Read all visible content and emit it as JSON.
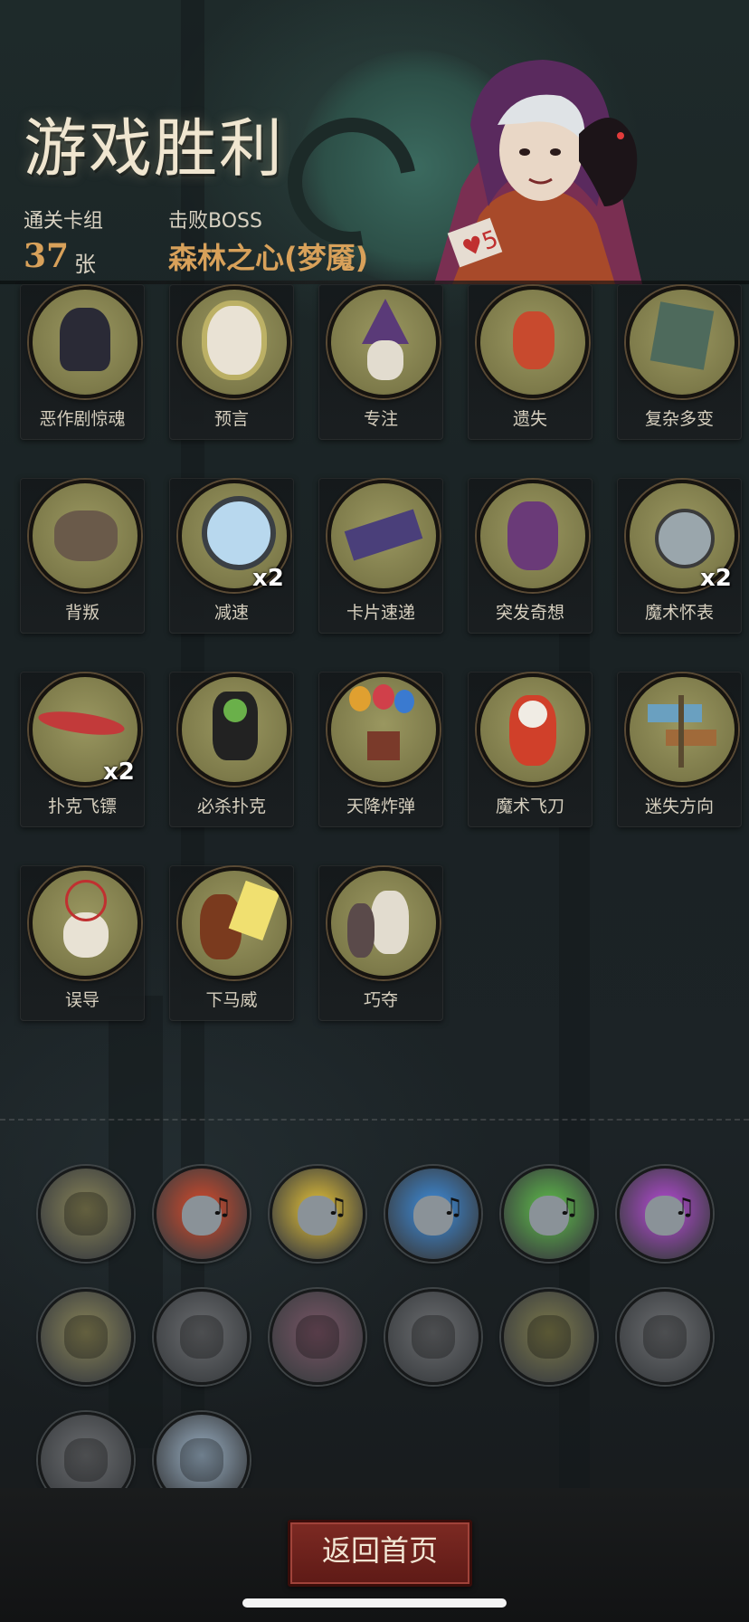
{
  "header": {
    "title": "游戏胜利",
    "deck_label": "通关卡组",
    "deck_count": "37",
    "deck_unit": "张",
    "boss_label": "击败BOSS",
    "boss_name": "森林之心(梦魇)"
  },
  "cards": [
    {
      "label": "恶作剧惊魂",
      "icon": "prank-ghost-icon"
    },
    {
      "label": "预言",
      "icon": "prophecy-sage-icon"
    },
    {
      "label": "专注",
      "icon": "focus-wizard-icon"
    },
    {
      "label": "遗失",
      "icon": "lost-pirate-icon"
    },
    {
      "label": "复杂多变",
      "icon": "complex-cube-icon"
    },
    {
      "label": "背叛",
      "icon": "betrayal-icon"
    },
    {
      "label": "减速",
      "icon": "slow-mirror-icon",
      "multiplier": "x2"
    },
    {
      "label": "卡片速递",
      "icon": "card-express-icon"
    },
    {
      "label": "突发奇想",
      "icon": "sudden-idea-icon"
    },
    {
      "label": "魔术怀表",
      "icon": "magic-pocketwatch-icon",
      "multiplier": "x2"
    },
    {
      "label": "扑克飞镖",
      "icon": "poker-dart-icon",
      "multiplier": "x2"
    },
    {
      "label": "必杀扑克",
      "icon": "killer-poker-icon"
    },
    {
      "label": "天降炸弹",
      "icon": "balloon-bomb-icon"
    },
    {
      "label": "魔术飞刀",
      "icon": "magic-knife-clown-icon"
    },
    {
      "label": "迷失方向",
      "icon": "lost-direction-signpost-icon"
    },
    {
      "label": "误导",
      "icon": "misdirect-skull-icon"
    },
    {
      "label": "下马威",
      "icon": "intimidation-icon"
    },
    {
      "label": "巧夺",
      "icon": "snatch-icon"
    }
  ],
  "relics": [
    {
      "icon": "handcuffs-relic-icon",
      "color": "#8a8557"
    },
    {
      "icon": "music-skull-red-relic-icon",
      "color": "#d94a2a"
    },
    {
      "icon": "music-skull-yellow-relic-icon",
      "color": "#e8c437"
    },
    {
      "icon": "music-skull-blue-relic-icon",
      "color": "#3c8ee0"
    },
    {
      "icon": "music-skull-green-relic-icon",
      "color": "#5fc04a"
    },
    {
      "icon": "music-skull-purple-relic-icon",
      "color": "#b84ad8"
    },
    {
      "icon": "beans-relic-icon",
      "color": "#8a8557"
    },
    {
      "icon": "bleeding-hands-relic-icon",
      "color": "#6b6d70"
    },
    {
      "icon": "gargoyle-statue-relic-icon",
      "color": "#7a5566"
    },
    {
      "icon": "magic-hand-relic-icon",
      "color": "#6b6d70"
    },
    {
      "icon": "slow-mirror-relic-icon",
      "color": "#7d7a4a"
    },
    {
      "icon": "warrior-relic-icon",
      "color": "#6b6d70"
    },
    {
      "icon": "bleeding-hands-2-relic-icon",
      "color": "#6b6d70"
    },
    {
      "icon": "throwing-knife-relic-icon",
      "color": "#9ab0c4"
    }
  ],
  "footer": {
    "home_button": "返回首页"
  }
}
